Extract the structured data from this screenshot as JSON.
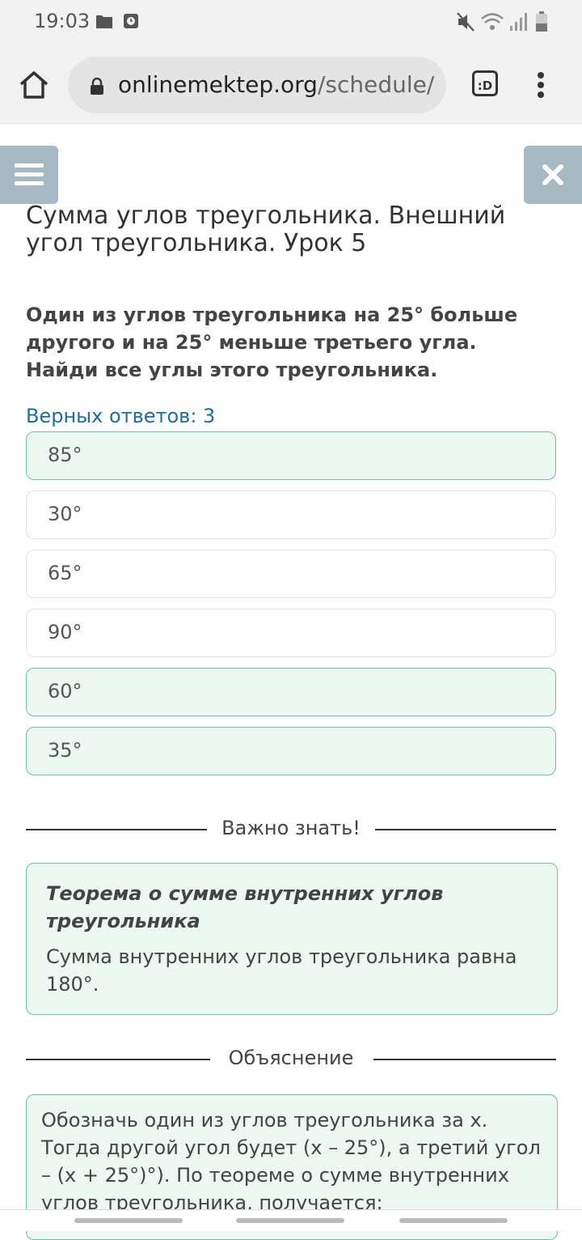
{
  "status_bar": {
    "time": "19:03",
    "icons_left": [
      "folder-icon",
      "clock-icon"
    ],
    "icons_right": [
      "mute-icon",
      "wifi-icon",
      "signal-icon",
      "battery-icon"
    ]
  },
  "browser": {
    "url_domain": "onlinemektep.org",
    "url_path": "/schedule/",
    "tabs_label": ":D"
  },
  "lesson": {
    "title": "Сумма углов треугольника. Внешний угол треугольника. Урок 5",
    "question": "Один из углов треугольника на 25° больше другого и на 25° меньше третьего угла. Найди все углы этого треугольника.",
    "correct_count_label": "Верных ответов: 3",
    "options": [
      {
        "label": "85°",
        "selected": true
      },
      {
        "label": "30°",
        "selected": false
      },
      {
        "label": "65°",
        "selected": false
      },
      {
        "label": "90°",
        "selected": false
      },
      {
        "label": "60°",
        "selected": true
      },
      {
        "label": "35°",
        "selected": true
      }
    ]
  },
  "important": {
    "heading": "Важно знать!",
    "theorem_title": "Теорема о сумме внутренних углов треугольника",
    "theorem_text": "Сумма внутренних углов треугольника равна 180°."
  },
  "explanation": {
    "heading": "Объяснение",
    "text": "Обозначь один из углов треугольника за x. Тогда другой угол будет (x – 25°), а третий угол – (x + 25°)°). По теореме о сумме внутренних углов треугольника, получается:"
  },
  "colors": {
    "accent_blue": "#1d6f9b",
    "selected_border": "#6ec1a2",
    "selected_bg": "#eef8f3",
    "side_button": "#a7b9c3"
  }
}
